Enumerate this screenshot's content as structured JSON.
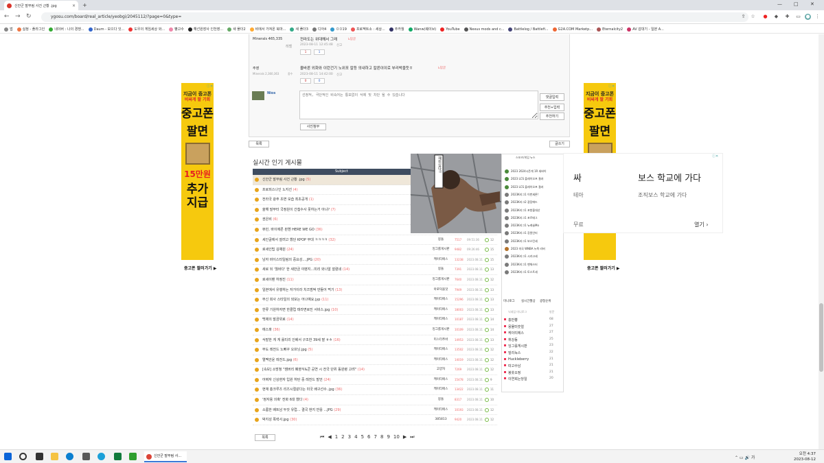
{
  "browser": {
    "tab_title": "신안군 말부림 사건 근황 .jpg",
    "tab_close": "×",
    "new_tab": "+",
    "url": "ygosu.com/board/real_article/yeobgi/2045112/?page=0&type=",
    "bookmarks": [
      "앱",
      "실정 - 플라그인",
      "네이버 : 나의 경쟁...",
      "Daum - 모으다 잇...",
      "도우의 게임세상 와...",
      "빵고수",
      "해선원장사 인천영...",
      "새 폴더2",
      "비에서 가져온 북마...",
      "새 폴더3",
      "디아4",
      "ㅁㅁ19",
      "프로젝트소 : 세상...",
      "추카월",
      "Wanw(웨이브)",
      "YouTube",
      "Nexus mods and c...",
      "Battlelog / Battlefi...",
      "G2A.COM Marketp...",
      "Eternalcity2",
      "AV 감대기 - 일본 A..."
    ]
  },
  "comments": [
    {
      "nick": "Minerals 465,335",
      "level": "레벨",
      "text": "전라도는 위대해서 그래",
      "time": "2023-08-11 12:45:48",
      "reply": "신고",
      "tag": "↳답글",
      "up": "1",
      "down": "1"
    },
    {
      "nick": "주영",
      "sub": "Minerals 2,360,363",
      "level": "중수",
      "text": "올바른 외화와 이런건기 노위포 칼등 의내하고 칼른이이로 부리박을듯ㅎ",
      "time": "2023-08-11 14:42:00",
      "reply": "신고",
      "tag": "↳답글",
      "up": "0",
      "down": "0"
    }
  ],
  "reply_form": {
    "user": "Nios",
    "placeholder": "선정적, 극단적인 비속어는 통보없이 삭제 및 차단 될 수 있습니다",
    "submit": "댓글입력",
    "btn2": "추천+입력",
    "btn3": "추천하기",
    "attach": "사진첨부"
  },
  "post_actions": {
    "list": "목록",
    "write": "글쓰기"
  },
  "popular": {
    "title": "실시간 인기 게시물",
    "subject_header": "Subject",
    "rows": [
      {
        "title": "신안군 말부림 사건 근황 .jpg",
        "cc": "(5)",
        "author": "",
        "views": "",
        "date": "",
        "rank": "",
        "sel": true
      },
      {
        "title": "프로피스나인 노지선",
        "cc": "(4)",
        "author": "",
        "views": "",
        "date": "",
        "rank": ""
      },
      {
        "title": "전라국 광주 초면 모습 최초공개",
        "cc": "(1)",
        "author": "",
        "views": "",
        "date": "",
        "rank": ""
      },
      {
        "title": "올해 말부터 국정원이 간첩수사 못하는거 아냐?",
        "cc": "(7)",
        "author": "",
        "views": "",
        "date": "",
        "rank": ""
      },
      {
        "title": "권은비",
        "cc": "(6)",
        "author": "",
        "views": "",
        "date": "",
        "rank": ""
      },
      {
        "title": "뷰민, 바이에른 뮌헨 HERE WE GO",
        "cc": "(36)",
        "author": "385813",
        "views": "1989",
        "date": "09:52:06",
        "rank": "12"
      },
      {
        "title": "세인글에서 잘려고 했던 KPOP 무대 ㅋㅋㅋㅋ",
        "cc": "(32)",
        "author": "몽돌",
        "views": "7517",
        "date": "09:51:36",
        "rank": "12"
      },
      {
        "title": "로세인팁 김채원",
        "cc": "(24)",
        "author": "잉그를게시판",
        "views": "9482",
        "date": "09:26:46",
        "rank": "15"
      },
      {
        "title": "남자 바이스타일링의 중요성....JPG",
        "cc": "(20)",
        "author": "케이티에스",
        "views": "13238",
        "date": "2023.08.11",
        "rank": "15"
      },
      {
        "title": "새로 뒤 '뭘바다' 한 새만금 야영지...미리 와나알 잘렸네",
        "cc": "(14)",
        "author": "몽돌",
        "views": "7391",
        "date": "2023.08.11",
        "rank": "13"
      },
      {
        "title": "로세이팬 하정진",
        "cc": "(11)",
        "author": "잉그를게시판",
        "views": "7640",
        "date": "2023.08.11",
        "rank": "12"
      },
      {
        "title": "일본에서 유행하는 자가이라 치즈범벅 만들어 먹기",
        "cc": "(13)",
        "author": "아로덕을맛",
        "views": "7949",
        "date": "2023.08.11",
        "rank": "13"
      },
      {
        "title": "무신 회사 스타일의 외모는 어나예요.jyp",
        "cc": "(11)",
        "author": "케이티에스",
        "views": "15296",
        "date": "2023.08.11",
        "rank": "13"
      },
      {
        "title": "한류 기원하자면 한클럽 태라면로진 서비스.jpg",
        "cc": "(10)",
        "author": "케이티에스",
        "views": "18003",
        "date": "2023.08.11",
        "rank": "13"
      },
      {
        "title": "백제의 말곰위로",
        "cc": "(14)",
        "author": "케이티에스",
        "views": "10187",
        "date": "2023.08.11",
        "rank": "14"
      },
      {
        "title": "에스파",
        "cc": "(36)",
        "author": "잉그를게시판",
        "views": "10109",
        "date": "2023.08.11",
        "rank": "14"
      },
      {
        "title": "삭발한 게 게 롤티리 인베서 구조한 39세 딸 ㅎㅎ",
        "cc": "(16)",
        "author": "미스터추바",
        "views": "14953",
        "date": "2023.08.11",
        "rank": "13"
      },
      {
        "title": "무도 레전드 노빠꾸 오프닝.jpg",
        "cc": "(5)",
        "author": "케이티에스",
        "views": "13502",
        "date": "2023.08.11",
        "rank": "12"
      },
      {
        "title": "엘멕안윤 레전드.jpg",
        "cc": "(6)",
        "author": "케이티에스",
        "views": "14019",
        "date": "2023.08.11",
        "rank": "12"
      },
      {
        "title": "[속보] 소방청 \"잼버리 폐영식&콘 공연 시 전국 단위 동원령 고려\"",
        "cc": "(14)",
        "author": "고양자",
        "views": "7269",
        "date": "2023.08.11",
        "rank": "12"
      },
      {
        "title": "어쩌자 신상현자 입원 하탄 중 레전드 발언",
        "cc": "(24)",
        "author": "케이티에스",
        "views": "15478",
        "date": "2023.08.11",
        "rank": "9"
      },
      {
        "title": "현재 흥크루즈 리즈시절같다는 미국 배구선수..jpg",
        "cc": "(36)",
        "author": "케이티에스",
        "views": "13422",
        "date": "2023.08.11",
        "rank": "11"
      },
      {
        "title": "'정자용 의혹' 전화 6대 했다",
        "cc": "(4)",
        "author": "몽돌",
        "views": "8317",
        "date": "2023.08.11",
        "rank": "10"
      },
      {
        "title": "소름한 배트남 두앗 유럽... 결국 현지 반응 ...JPG",
        "cc": "(29)",
        "author": "케이티에스",
        "views": "10193",
        "date": "2023.08.11",
        "rank": "12"
      },
      {
        "title": "박지성 폭력사.jpg",
        "cc": "(30)",
        "author": "385813",
        "views": "9420",
        "date": "2023.08.11",
        "rank": "12"
      }
    ]
  },
  "pagination": {
    "first": "⏮",
    "prev": "◀",
    "pages": [
      "1",
      "2",
      "3",
      "4",
      "5",
      "6",
      "7",
      "8",
      "9",
      "10"
    ],
    "next": "▶",
    "last": "⏭",
    "list_btn": "목록"
  },
  "overlay": {
    "speech": "재미있다!!",
    "header": "스포츠/게임 뉴스"
  },
  "sidebar": {
    "news": [
      "2023 2024시즌게 1R 새바이",
      "2023 LCS 플레이오프 결과",
      "2023 LCS 플레이오프 결과",
      "2023K리그1 이번세론!",
      "2023K리그2 광장애드",
      "2023K리그1 포항을대산",
      "2023K리그1 포르테그",
      "2023K리그1 뉴캐슬Mo",
      "2023K리그1 강원인터",
      "2023K리그1 보스턴세",
      "2023 미국 WNBA 뉴욕 리버",
      "2023K리그1 시카고세",
      "2023K리그1 맨체스터",
      "2023K리그1 토스트세"
    ],
    "tabs": [
      "미니로그",
      "실시간월상",
      "광청순위"
    ],
    "gallery_header": "닉네임 미니로그",
    "gallery_count_header": "방문",
    "gallery": [
      {
        "name": "홍반뿅",
        "count": "68"
      },
      {
        "name": "몽물미숫얼",
        "count": "27"
      },
      {
        "name": "케이티에스",
        "count": "27"
      },
      {
        "name": "휘강동",
        "count": "25"
      },
      {
        "name": "잉그를게시판",
        "count": "23"
      },
      {
        "name": "빌리녹스",
        "count": "22"
      },
      {
        "name": "Huckleberry",
        "count": "21"
      },
      {
        "name": "따고수남",
        "count": "21"
      },
      {
        "name": "봉쏫오정",
        "count": "21"
      },
      {
        "name": "이연희는당일",
        "count": "20"
      }
    ]
  },
  "side_ads": {
    "line1": "지금이 중고폰",
    "line2": "비싸게 팔 기회",
    "big1": "중고폰",
    "big2": "팔면",
    "price": "15만원",
    "big3": "추가",
    "big4": "지급",
    "link": "중고폰 팔러가기 ▶",
    "badge": "ⓘ✕"
  },
  "mid_ad": {
    "headline": "싸",
    "headline_rest": "보스 학교에 가다",
    "sub": "테아",
    "sub_rest": "조직보스 학교에 가다",
    "footer_left": "무료",
    "footer_right": "열기 ›",
    "badge": "ⓘ✕"
  },
  "taskbar": {
    "task_label": "신안군 말부림 사...",
    "time": "오전 4:37",
    "date": "2023-08-12"
  }
}
